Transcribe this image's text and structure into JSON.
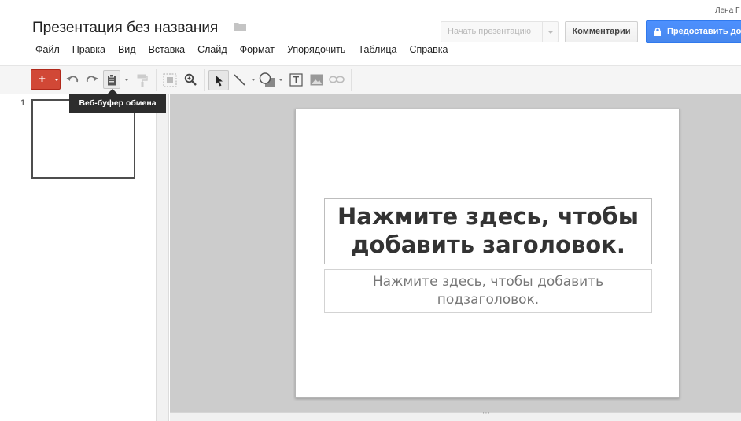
{
  "header": {
    "user_name": "Лена Г",
    "doc_title": "Презентация без названия",
    "present_button": "Начать презентацию",
    "comments_button": "Комментарии",
    "share_button": "Предоставить доступ"
  },
  "menu": {
    "items": [
      {
        "label": "Файл"
      },
      {
        "label": "Правка"
      },
      {
        "label": "Вид"
      },
      {
        "label": "Вставка"
      },
      {
        "label": "Слайд"
      },
      {
        "label": "Формат"
      },
      {
        "label": "Упорядочить"
      },
      {
        "label": "Таблица"
      },
      {
        "label": "Справка"
      }
    ]
  },
  "toolbar": {
    "add_label": "+",
    "tooltip": "Веб-буфер обмена",
    "icons": [
      "new-slide-icon",
      "undo-icon",
      "redo-icon",
      "clipboard-icon",
      "paint-format-icon",
      "zoom-fit-icon",
      "zoom-icon",
      "select-icon",
      "line-icon",
      "shape-icon",
      "text-box-icon",
      "image-icon",
      "link-icon"
    ]
  },
  "filmstrip": {
    "slides": [
      {
        "number": "1"
      }
    ]
  },
  "slide": {
    "title_placeholder": "Нажмите здесь, чтобы добавить заголовок.",
    "subtitle_placeholder": "Нажмите здесь, чтобы добавить подзаголовок."
  },
  "colors": {
    "add_button": "#d14836",
    "share_button": "#4d90fe",
    "canvas_bg": "#cccccc",
    "tooltip_bg": "#2d2d2d"
  }
}
